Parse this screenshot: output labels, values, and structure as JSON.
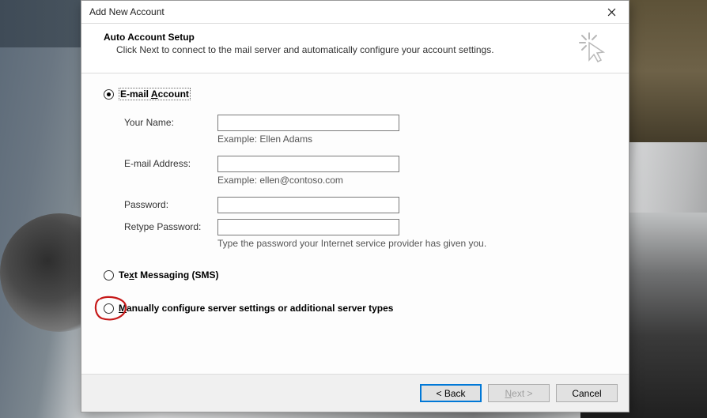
{
  "window": {
    "title": "Add New Account",
    "close_icon": "close"
  },
  "header": {
    "title": "Auto Account Setup",
    "subtitle": "Click Next to connect to the mail server and automatically configure your account settings."
  },
  "options": {
    "email": {
      "label_pre": "E-mail ",
      "label_ul": "A",
      "label_post": "ccount",
      "selected": true
    },
    "sms": {
      "label_pre": "Te",
      "label_ul": "x",
      "label_post": "t Messaging (SMS)",
      "selected": false
    },
    "manual": {
      "label_pre": "",
      "label_ul": "M",
      "label_post": "anually configure server settings or additional server types",
      "selected": false,
      "annotated": true
    }
  },
  "form": {
    "name": {
      "label": "Your Name:",
      "value": "",
      "hint": "Example: Ellen Adams"
    },
    "email": {
      "label": "E-mail Address:",
      "value": "",
      "hint": "Example: ellen@contoso.com"
    },
    "password": {
      "label": "Password:",
      "value": ""
    },
    "retype": {
      "label": "Retype Password:",
      "value": "",
      "hint": "Type the password your Internet service provider has given you."
    }
  },
  "buttons": {
    "back": "< Back",
    "next_pre": "",
    "next_ul": "N",
    "next_post": "ext >",
    "cancel": "Cancel"
  }
}
